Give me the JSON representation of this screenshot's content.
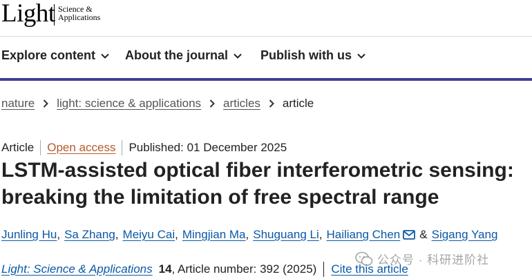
{
  "logo": {
    "main": "Light",
    "sub_line1": "Science &",
    "sub_line2": "Applications"
  },
  "nav": {
    "items": [
      {
        "label": "Explore content",
        "icon": "chevron-down-icon"
      },
      {
        "label": "About the journal",
        "icon": "chevron-down-icon"
      },
      {
        "label": "Publish with us",
        "icon": "chevron-down-icon"
      }
    ],
    "accent_color": "#3d3f93"
  },
  "breadcrumb": {
    "items": [
      "nature",
      "light: science & applications",
      "articles"
    ],
    "current": "article",
    "separator_icon": "chevron-right-icon"
  },
  "meta": {
    "type": "Article",
    "access": "Open access",
    "published": "Published: 01 December 2025"
  },
  "title": "LSTM-assisted optical fiber interferometric sensing: breaking the limitation of free spectral range",
  "authors": {
    "list": [
      "Junling Hu",
      "Sa Zhang",
      "Meiyu Cai",
      "Mingjian Ma",
      "Shuguang Li",
      "Hailiang Chen"
    ],
    "separator": ",",
    "ampersand": "&",
    "last": "Sigang Yang",
    "mail_icon": "mail-icon"
  },
  "citation": {
    "journal": "Light: Science & Applications",
    "volume": "14",
    "article_number": ", Article number: 392 (2025)",
    "cite_label": "Cite this article"
  },
  "watermark": {
    "text": "公众号 · 科研进阶社",
    "icon": "wechat-icon"
  },
  "colors": {
    "link": "#0a58a6",
    "open_access": "#b65a2b",
    "nav_bar": "#3d3f93"
  }
}
